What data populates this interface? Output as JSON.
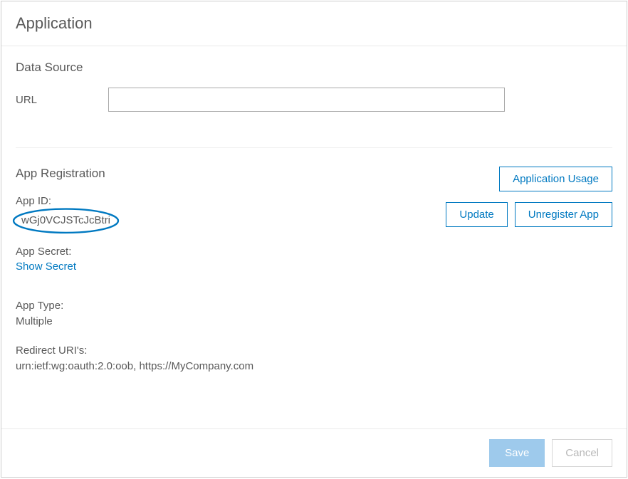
{
  "header": {
    "title": "Application"
  },
  "dataSource": {
    "section_title": "Data Source",
    "url_label": "URL",
    "url_value": ""
  },
  "appRegistration": {
    "section_title": "App Registration",
    "app_id_label": "App ID:",
    "app_id_value": "wGj0VCJSTcJcBtri",
    "app_secret_label": "App Secret:",
    "show_secret_label": "Show Secret",
    "app_type_label": "App Type:",
    "app_type_value": "Multiple",
    "redirect_uris_label": "Redirect URI's:",
    "redirect_uris_value": "urn:ietf:wg:oauth:2.0:oob, https://MyCompany.com",
    "buttons": {
      "usage": "Application Usage",
      "update": "Update",
      "unregister": "Unregister App"
    }
  },
  "footer": {
    "save_label": "Save",
    "cancel_label": "Cancel"
  },
  "colors": {
    "accent": "#0079c1",
    "highlight_circle": "#0079c1",
    "save_bg": "#9ecaec"
  }
}
